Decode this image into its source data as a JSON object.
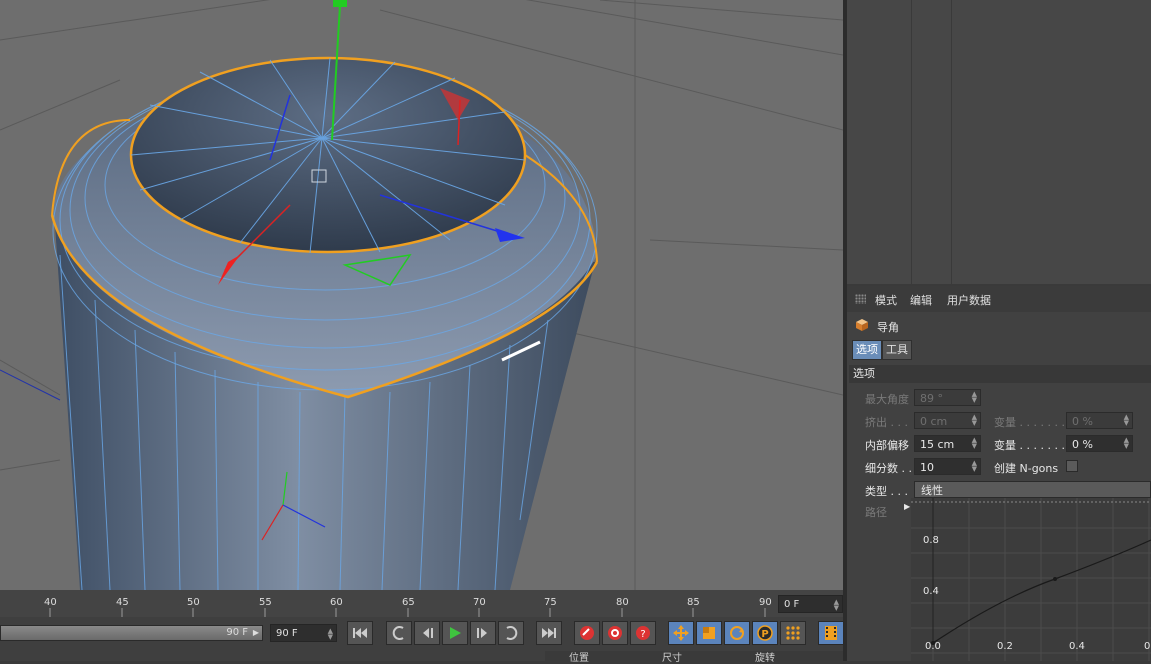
{
  "attribute_manager": {
    "menu": [
      "模式",
      "编辑",
      "用户数据"
    ],
    "object_name": "导角",
    "tabs": [
      "选项",
      "工具"
    ],
    "section_title": "选项",
    "params": {
      "max_angle": {
        "label": "最大角度",
        "value": "89 °"
      },
      "extrude": {
        "label": "挤出 . . .",
        "value": "0 cm"
      },
      "variance1": {
        "label": "变量 . . . . . . .",
        "value": "0 %"
      },
      "inner_offset": {
        "label": "内部偏移",
        "value": "15 cm"
      },
      "variance2": {
        "label": "变量 . . . . . . .",
        "value": "0 %"
      },
      "subdivision": {
        "label": "细分数 . .",
        "value": "10"
      },
      "create_ngons": {
        "label": "创建 N-gons",
        "checked": false
      },
      "type": {
        "label": "类型 . . .",
        "value": "线性"
      },
      "path": {
        "label": "路径"
      }
    },
    "graph": {
      "y_ticks": [
        "0.8",
        "0.4",
        "0.0"
      ],
      "x_ticks": [
        "0.0",
        "0.2",
        "0.4",
        "0"
      ]
    }
  },
  "timeline": {
    "ticks": [
      "40",
      "45",
      "50",
      "55",
      "60",
      "65",
      "70",
      "75",
      "80",
      "85",
      "90"
    ],
    "current_frame": "0 F"
  },
  "controls": {
    "slider_value": "90 F",
    "end_frame": "90 F"
  },
  "coord_strip": [
    "位置",
    "尺寸",
    "旋转"
  ],
  "colors": {
    "selection_orange": "#f0a020",
    "wire_blue": "#6aa8e8",
    "active_tab": "#6a8db8"
  }
}
